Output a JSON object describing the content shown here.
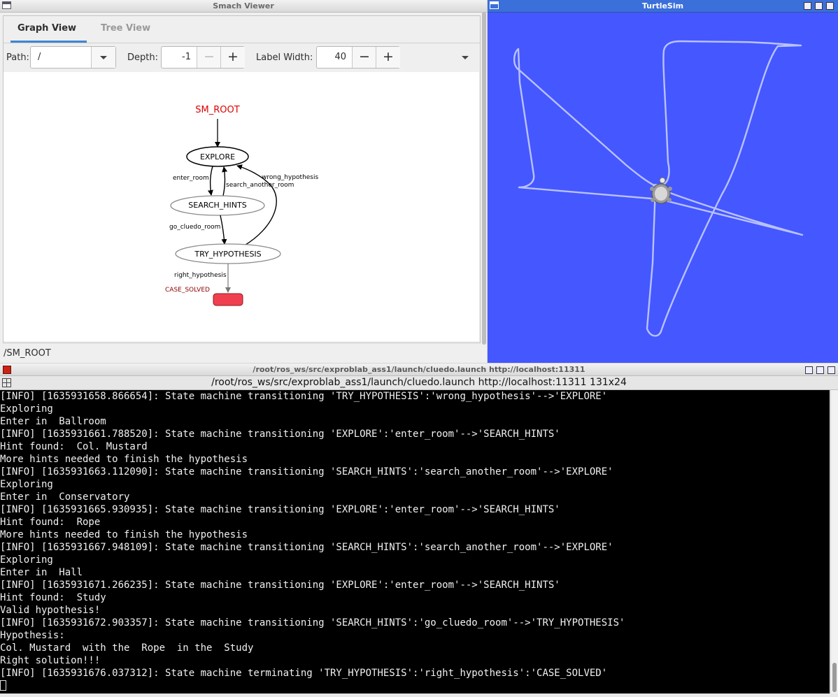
{
  "smach": {
    "title": "Smach Viewer",
    "tabs": [
      "Graph View",
      "Tree View"
    ],
    "path_label": "Path:",
    "path_value": "/",
    "depth_label": "Depth:",
    "depth_value": "-1",
    "label_width_label": "Label Width:",
    "label_width_value": "40",
    "minus": "−",
    "plus": "+",
    "status_path": "/SM_ROOT",
    "graph": {
      "root_label": "SM_ROOT",
      "states": {
        "explore": "EXPLORE",
        "search_hints": "SEARCH_HINTS",
        "try_hypothesis": "TRY_HYPOTHESIS"
      },
      "outcome": "CASE_SOLVED",
      "transitions": {
        "enter_room": "enter_room",
        "search_another_room": "search_another_room",
        "wrong_hypothesis": "wrong_hypothesis",
        "go_cluedo_room": "go_cluedo_room",
        "right_hypothesis": "right_hypothesis"
      },
      "colors": {
        "root": "#e00000",
        "outcome_fill": "#f04050",
        "outcome_label": "#8b0000"
      }
    }
  },
  "turtlesim": {
    "title": "TurtleSim",
    "background_color": "#4557ff",
    "trail_color": "#b8c2ff"
  },
  "terminal": {
    "title": "/root/ros_ws/src/exproblab_ass1/launch/cluedo.launch http://localhost:11311",
    "header": "/root/ros_ws/src/exproblab_ass1/launch/cluedo.launch http://localhost:11311 131x24",
    "lines": [
      "[INFO] [1635931658.866654]: State machine transitioning 'TRY_HYPOTHESIS':'wrong_hypothesis'-->'EXPLORE'",
      "Exploring",
      "Enter in  Ballroom",
      "[INFO] [1635931661.788520]: State machine transitioning 'EXPLORE':'enter_room'-->'SEARCH_HINTS'",
      "Hint found:  Col. Mustard",
      "More hints needed to finish the hypothesis",
      "[INFO] [1635931663.112090]: State machine transitioning 'SEARCH_HINTS':'search_another_room'-->'EXPLORE'",
      "Exploring",
      "Enter in  Conservatory",
      "[INFO] [1635931665.930935]: State machine transitioning 'EXPLORE':'enter_room'-->'SEARCH_HINTS'",
      "Hint found:  Rope",
      "More hints needed to finish the hypothesis",
      "[INFO] [1635931667.948109]: State machine transitioning 'SEARCH_HINTS':'search_another_room'-->'EXPLORE'",
      "Exploring",
      "Enter in  Hall",
      "[INFO] [1635931671.266235]: State machine transitioning 'EXPLORE':'enter_room'-->'SEARCH_HINTS'",
      "Hint found:  Study",
      "Valid hypothesis!",
      "[INFO] [1635931672.903357]: State machine transitioning 'SEARCH_HINTS':'go_cluedo_room'-->'TRY_HYPOTHESIS'",
      "Hypothesis:",
      "Col. Mustard  with the  Rope  in the  Study",
      "Right solution!!!",
      "[INFO] [1635931676.037312]: State machine terminating 'TRY_HYPOTHESIS':'right_hypothesis':'CASE_SOLVED'"
    ]
  }
}
